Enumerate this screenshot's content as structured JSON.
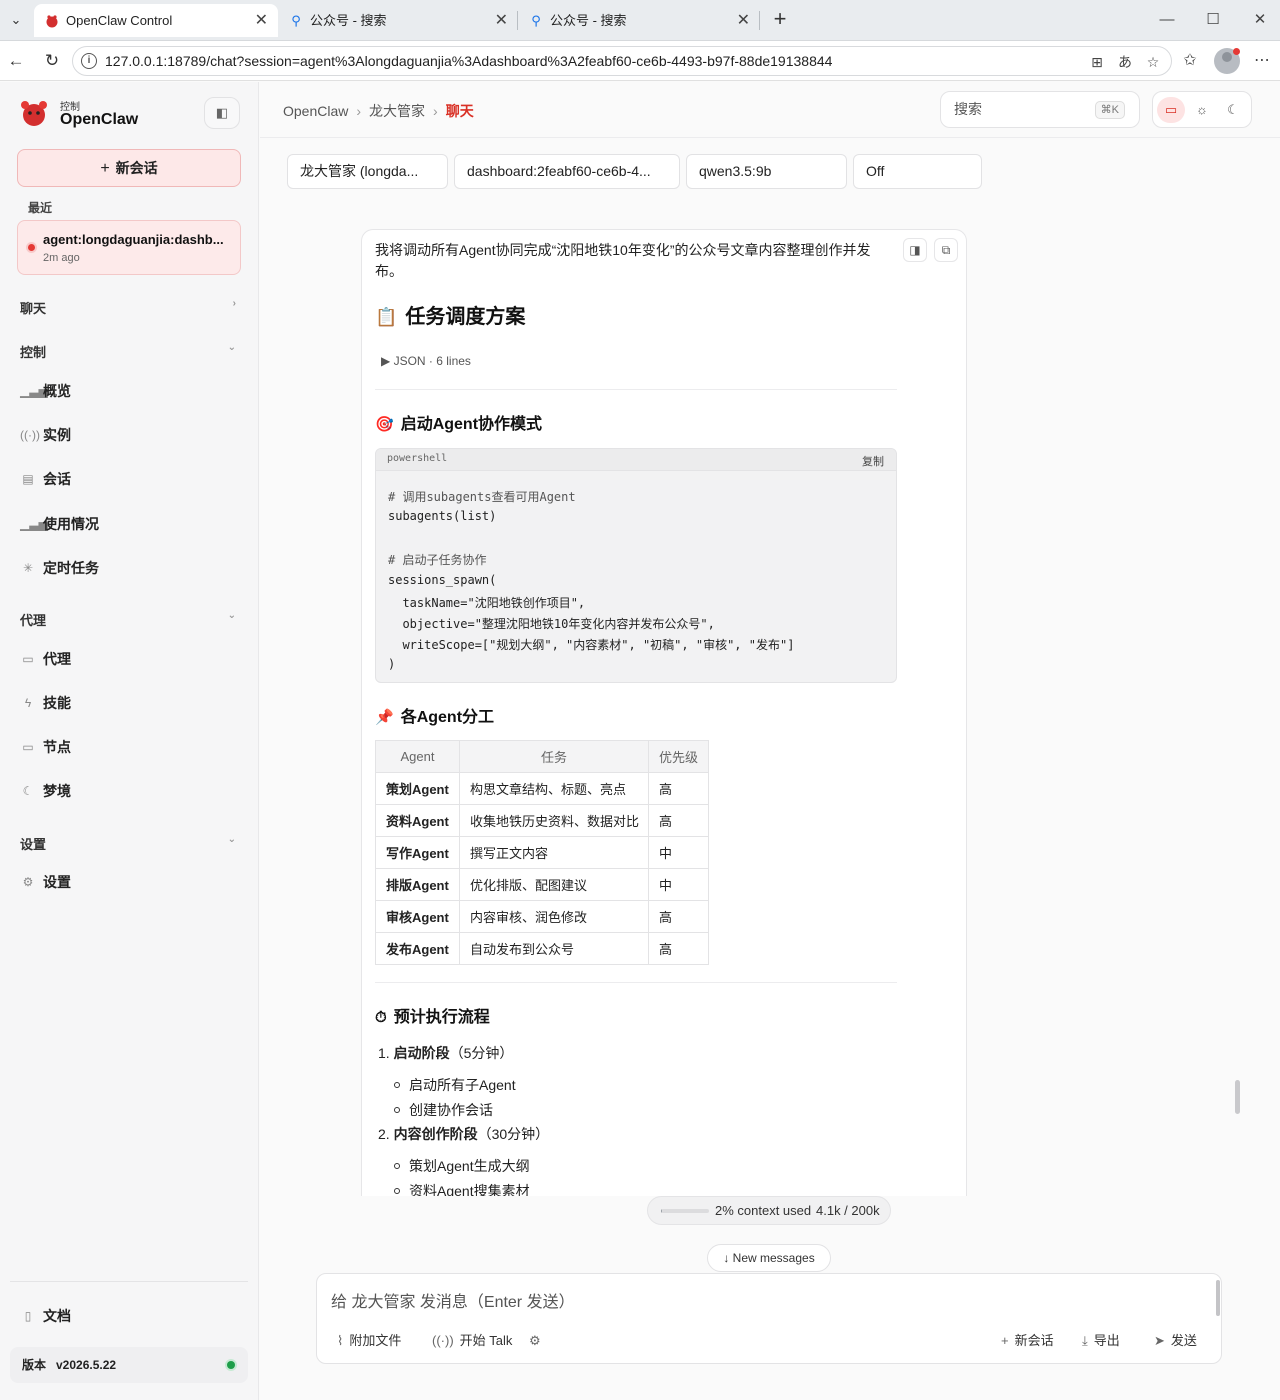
{
  "browser": {
    "tabs": [
      {
        "title": "OpenClaw Control",
        "close": "✕"
      },
      {
        "title": "公众号 - 搜索",
        "close": "✕"
      },
      {
        "title": "公众号 - 搜索",
        "close": "✕"
      }
    ],
    "url": "127.0.0.1:18789/chat?session=agent%3Alongdaguanjia%3Adashboard%3A2feabf60-ce6b-4493-b97f-88de19138844",
    "icons": [
      "tab-list-icon",
      "search-favicon",
      "new-tab-icon",
      "minimize-icon",
      "maximize-icon",
      "close-window-icon",
      "back-icon",
      "reload-icon",
      "site-info-icon",
      "app-install-icon",
      "translate-icon",
      "favorite-star-icon",
      "favorites-icon",
      "profile-avatar-icon",
      "more-menu-icon"
    ]
  },
  "sidebar": {
    "brand_small": "控制",
    "brand_name": "OpenClaw",
    "new_chat_label": "新会话",
    "recent_label": "最近",
    "recent_session": {
      "title": "agent:longdaguanjia:dashb...",
      "time": "2m ago"
    },
    "groups": {
      "chat": "聊天",
      "control": "控制",
      "agent": "代理",
      "settings": "设置"
    },
    "control_items": [
      {
        "label": "概览",
        "icon": "bar-chart-icon"
      },
      {
        "label": "实例",
        "icon": "broadcast-icon"
      },
      {
        "label": "会话",
        "icon": "document-icon"
      },
      {
        "label": "使用情况",
        "icon": "bar-chart-icon"
      },
      {
        "label": "定时任务",
        "icon": "loader-icon"
      }
    ],
    "agent_items": [
      {
        "label": "代理",
        "icon": "folder-icon"
      },
      {
        "label": "技能",
        "icon": "lightning-icon"
      },
      {
        "label": "节点",
        "icon": "monitor-icon"
      },
      {
        "label": "梦境",
        "icon": "moon-icon"
      }
    ],
    "settings_items": [
      {
        "label": "设置",
        "icon": "gear-icon"
      }
    ],
    "docs_label": "文档",
    "version_label": "版本",
    "version_value": "v2026.5.22",
    "status_color": "#1e9e4a"
  },
  "header": {
    "breadcrumb": [
      "OpenClaw",
      "龙大管家",
      "聊天"
    ],
    "search_placeholder": "搜索",
    "search_shortcut": "⌘K",
    "accent_color": "#d93025"
  },
  "session_bar": {
    "agent": "龙大管家 (longda...",
    "session": "dashboard:2feabf60-ce6b-4...",
    "model": "qwen3.5:9b",
    "thinking": "Off"
  },
  "message": {
    "intro": "我将调动所有Agent协同完成“沈阳地铁10年变化”的公众号文章内容整理创作并发布。",
    "h1_emoji": "📋",
    "h1": "任务调度方案",
    "json_toggle": "▶ JSON · 6 lines",
    "h2_start_emoji": "🎯",
    "h2_start": "启动Agent协作模式",
    "code": {
      "lang": "powershell",
      "copy_label": "复制",
      "lines": [
        "# 调用subagents查看可用Agent",
        "subagents(list)",
        "",
        "# 启动子任务协作",
        "sessions_spawn(",
        "  taskName=\"沈阳地铁创作项目\",",
        "  objective=\"整理沈阳地铁10年变化内容并发布公众号\",",
        "  writeScope=[\"规划大纲\", \"内容素材\", \"初稿\", \"审核\", \"发布\"]",
        ")"
      ]
    },
    "h2_roles_emoji": "📌",
    "h2_roles": "各Agent分工",
    "table": {
      "headers": [
        "Agent",
        "任务",
        "优先级"
      ],
      "rows": [
        [
          "策划Agent",
          "构思文章结构、标题、亮点",
          "高"
        ],
        [
          "资料Agent",
          "收集地铁历史资料、数据对比",
          "高"
        ],
        [
          "写作Agent",
          "撰写正文内容",
          "中"
        ],
        [
          "排版Agent",
          "优化排版、配图建议",
          "中"
        ],
        [
          "审核Agent",
          "内容审核、润色修改",
          "高"
        ],
        [
          "发布Agent",
          "自动发布到公众号",
          "高"
        ]
      ]
    },
    "h2_flow_emoji": "⏱",
    "h2_flow": "预计执行流程",
    "steps": [
      {
        "num": "1.",
        "title": "启动阶段",
        "duration": "（5分钟）",
        "items": [
          "启动所有子Agent",
          "创建协作会话"
        ]
      },
      {
        "num": "2.",
        "title": "内容创作阶段",
        "duration": "（30分钟）",
        "items": [
          "策划Agent生成大纲",
          "资料Agent搜集素材"
        ]
      }
    ]
  },
  "context": {
    "used_fraction": 0.02,
    "percent_text": "2% context used",
    "tokens_text": "4.1k / 200k"
  },
  "new_messages_label": "New messages",
  "composer": {
    "placeholder": "给 龙大管家 发消息（Enter 发送）",
    "attach_label": "附加文件",
    "talk_label": "开始 Talk",
    "new_session_label": "新会话",
    "export_label": "导出",
    "send_label": "发送"
  }
}
